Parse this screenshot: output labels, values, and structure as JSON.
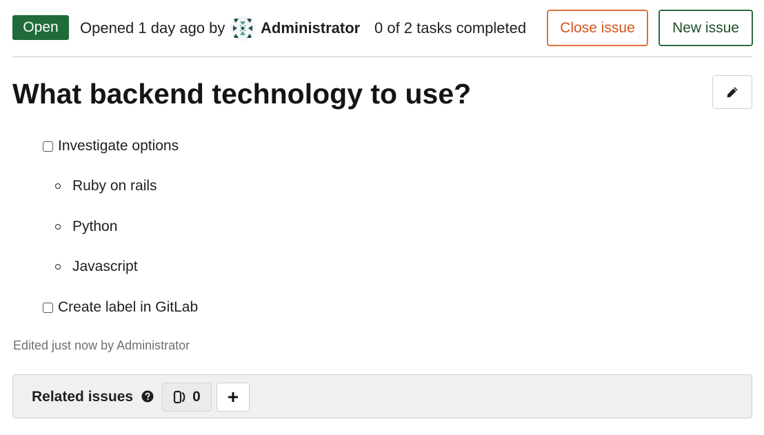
{
  "header": {
    "status": "Open",
    "opened_text": "Opened 1 day ago by",
    "author": "Administrator",
    "tasks_summary": "0 of 2 tasks completed",
    "close_label": "Close issue",
    "new_label": "New issue",
    "status_color": "#1f6b3a"
  },
  "issue": {
    "title": "What backend technology to use?",
    "edit_icon": "pencil-icon",
    "tasks": [
      {
        "label": "Investigate options",
        "checked": false,
        "subitems": [
          "Ruby on rails",
          "Python",
          "Javascript"
        ]
      },
      {
        "label": "Create label in GitLab",
        "checked": false
      }
    ],
    "edited_note": "Edited just now by Administrator"
  },
  "related": {
    "title": "Related issues",
    "help_icon": "question-circle-icon",
    "count": "0",
    "add_icon": "plus-icon"
  },
  "colors": {
    "close_accent": "#d4541a",
    "new_accent": "#1f4f2b"
  }
}
